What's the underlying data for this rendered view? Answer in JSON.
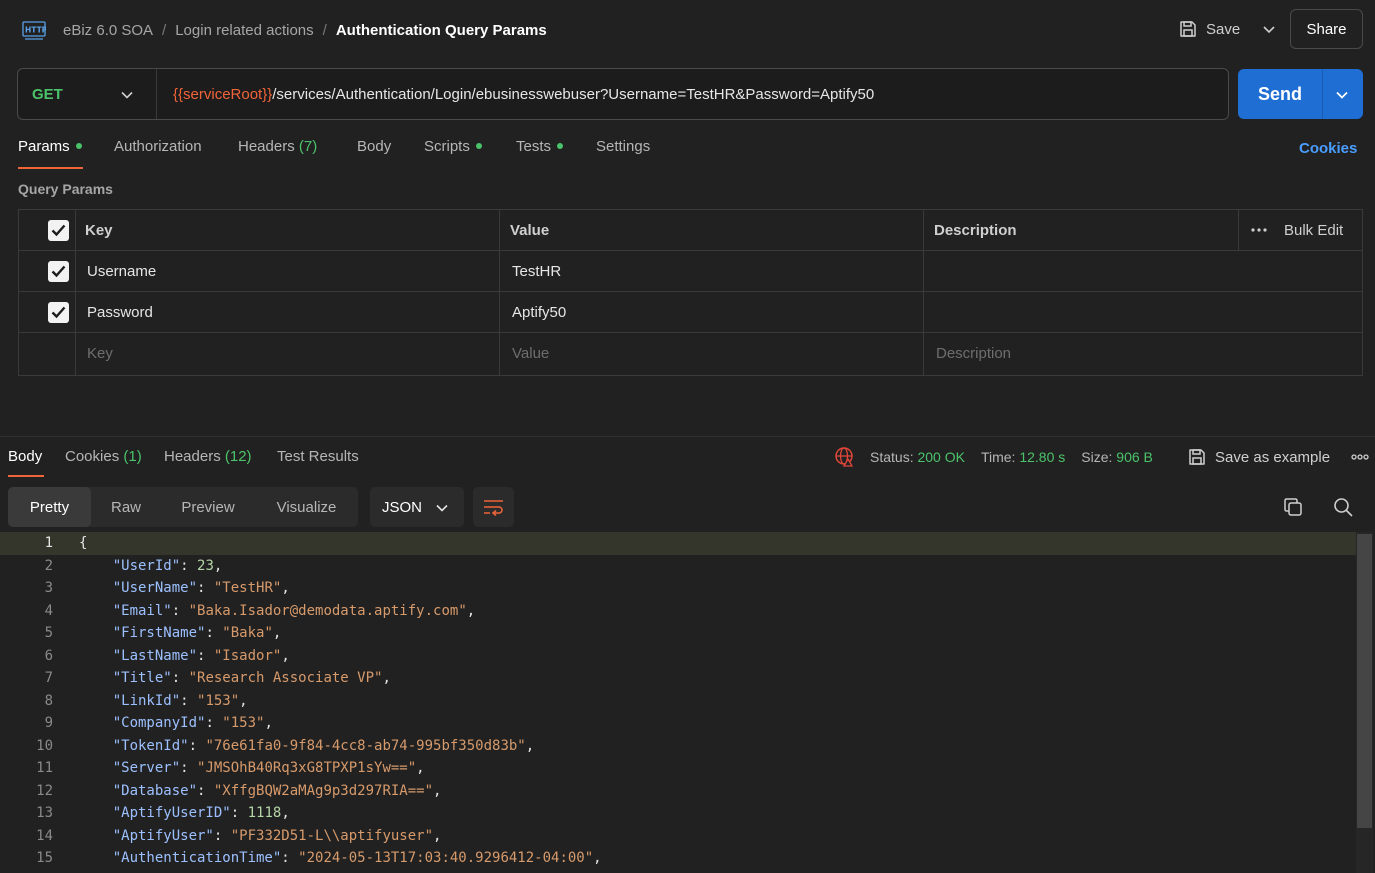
{
  "header": {
    "breadcrumb": [
      "eBiz 6.0 SOA",
      "Login related actions",
      "Authentication Query Params"
    ],
    "save_label": "Save",
    "share_label": "Share"
  },
  "request": {
    "method": "GET",
    "url_variable": "{{serviceRoot}}",
    "url_path": "/services/Authentication/Login/ebusinesswebuser?Username=TestHR&Password=Aptify50",
    "send_label": "Send"
  },
  "request_tabs": {
    "params": "Params",
    "authorization": "Authorization",
    "headers": "Headers",
    "headers_count": "(7)",
    "body": "Body",
    "scripts": "Scripts",
    "tests": "Tests",
    "settings": "Settings",
    "cookies": "Cookies"
  },
  "query_params": {
    "title": "Query Params",
    "columns": {
      "key": "Key",
      "value": "Value",
      "description": "Description",
      "bulk_edit": "Bulk Edit"
    },
    "rows": [
      {
        "key": "Username",
        "value": "TestHR",
        "description": ""
      },
      {
        "key": "Password",
        "value": "Aptify50",
        "description": ""
      }
    ],
    "placeholders": {
      "key": "Key",
      "value": "Value",
      "description": "Description"
    }
  },
  "response_tabs": {
    "body": "Body",
    "cookies": "Cookies",
    "cookies_count": "(1)",
    "headers": "Headers",
    "headers_count": "(12)",
    "test_results": "Test Results"
  },
  "response_meta": {
    "status_label": "Status:",
    "status_value": "200 OK",
    "time_label": "Time:",
    "time_value": "12.80 s",
    "size_label": "Size:",
    "size_value": "906 B",
    "save_example": "Save as example"
  },
  "view_modes": [
    "Pretty",
    "Raw",
    "Preview",
    "Visualize"
  ],
  "format": "JSON",
  "code_lines": [
    {
      "n": "1",
      "key": "",
      "value": "",
      "type": "open"
    },
    {
      "n": "2",
      "key": "\"UserId\"",
      "value": "23",
      "type": "num"
    },
    {
      "n": "3",
      "key": "\"UserName\"",
      "value": "\"TestHR\"",
      "type": "str"
    },
    {
      "n": "4",
      "key": "\"Email\"",
      "value": "\"Baka.Isador@demodata.aptify.com\"",
      "type": "str"
    },
    {
      "n": "5",
      "key": "\"FirstName\"",
      "value": "\"Baka\"",
      "type": "str"
    },
    {
      "n": "6",
      "key": "\"LastName\"",
      "value": "\"Isador\"",
      "type": "str"
    },
    {
      "n": "7",
      "key": "\"Title\"",
      "value": "\"Research Associate VP\"",
      "type": "str"
    },
    {
      "n": "8",
      "key": "\"LinkId\"",
      "value": "\"153\"",
      "type": "str"
    },
    {
      "n": "9",
      "key": "\"CompanyId\"",
      "value": "\"153\"",
      "type": "str"
    },
    {
      "n": "10",
      "key": "\"TokenId\"",
      "value": "\"76e61fa0-9f84-4cc8-ab74-995bf350d83b\"",
      "type": "str"
    },
    {
      "n": "11",
      "key": "\"Server\"",
      "value": "\"JMSOhB40Rq3xG8TPXP1sYw==\"",
      "type": "str"
    },
    {
      "n": "12",
      "key": "\"Database\"",
      "value": "\"XffgBQW2aMAg9p3d297RIA==\"",
      "type": "str"
    },
    {
      "n": "13",
      "key": "\"AptifyUserID\"",
      "value": "1118",
      "type": "num"
    },
    {
      "n": "14",
      "key": "\"AptifyUser\"",
      "value": "\"PF332D51-L\\\\aptifyuser\"",
      "type": "str"
    },
    {
      "n": "15",
      "key": "\"AuthenticationTime\"",
      "value": "\"2024-05-13T17:03:40.9296412-04:00\"",
      "type": "str"
    }
  ]
}
